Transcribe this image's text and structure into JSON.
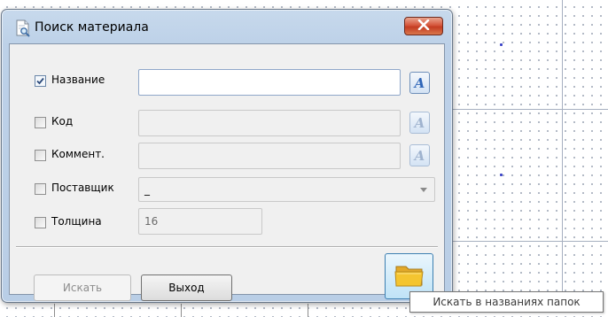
{
  "window": {
    "title": "Поиск материала",
    "close_icon": "close-icon"
  },
  "fields": [
    {
      "label": "Название",
      "checked": true,
      "value": "",
      "enabled": true,
      "case_icon": "A"
    },
    {
      "label": "Код",
      "checked": false,
      "value": "",
      "enabled": false,
      "case_icon": "A"
    },
    {
      "label": "Коммент.",
      "checked": false,
      "value": "",
      "enabled": false,
      "case_icon": "A"
    }
  ],
  "supplier": {
    "label": "Поставщик",
    "checked": false,
    "value": "_"
  },
  "thickness": {
    "label": "Толщина",
    "checked": false,
    "value": "16"
  },
  "buttons": {
    "search": "Искать",
    "exit": "Выход",
    "folder_icon": "folder-icon"
  },
  "tooltip": "Искать в названиях папок",
  "colors": {
    "accent": "#2f66b8",
    "close_red": "#c43c22",
    "folder_yellow": "#f4c530"
  }
}
